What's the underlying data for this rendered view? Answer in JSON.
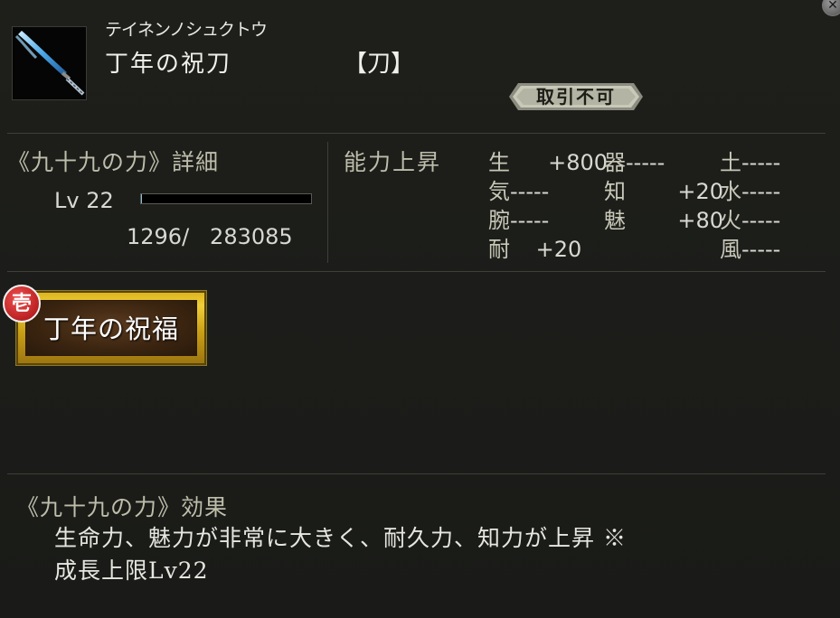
{
  "colors": {
    "accent_gold": "#d9b21c",
    "badge_red": "#c81e1e",
    "bg": "#1b1c19"
  },
  "item": {
    "icon": "sword-icon",
    "ruby": "テイネンノシュクトウ",
    "name": "丁年の祝刀",
    "type": "【刀】",
    "trade_status": "取引不可"
  },
  "detail": {
    "title": "《九十九の力》詳細",
    "level_label": "Lv 22",
    "exp_text": "1296/   283085",
    "exp_progress": 0.0046
  },
  "ability": {
    "title": "能力上昇",
    "stats": [
      {
        "key": "生",
        "value": "+800"
      },
      {
        "key": "気",
        "value": "-----"
      },
      {
        "key": "腕",
        "value": "-----"
      },
      {
        "key": "耐",
        "value": "+20"
      },
      {
        "key": "器",
        "value": "-----"
      },
      {
        "key": "知",
        "value": "+20"
      },
      {
        "key": "魅",
        "value": "+80"
      },
      {
        "key": "土",
        "value": "-----"
      },
      {
        "key": "水",
        "value": "-----"
      },
      {
        "key": "火",
        "value": "-----"
      },
      {
        "key": "風",
        "value": "-----"
      }
    ]
  },
  "skill": {
    "rank_label": "壱",
    "name": "丁年の祝福"
  },
  "effect": {
    "title": "《九十九の力》効果",
    "line1": "生命力、魅力が非常に大きく、耐久力、知力が上昇 ※",
    "line2": "成長上限Lv22"
  }
}
